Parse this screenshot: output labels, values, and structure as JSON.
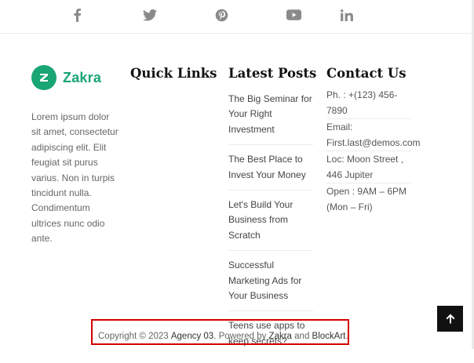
{
  "social": {
    "icons": [
      "facebook-icon",
      "twitter-icon",
      "pinterest-icon",
      "youtube-icon",
      "linkedin-icon"
    ],
    "icon_color": "#8a8a8a"
  },
  "brand": {
    "name": "Zakra",
    "color": "#19a574",
    "about": "Lorem ipsum dolor sit amet, consectetur adipiscing elit. Elit feugiat sit purus varius. Non in turpis tincidunt nulla. Condimentum ultrices nunc odio ante."
  },
  "columns": {
    "quick_links_title": "Quick Links",
    "latest_posts_title": "Latest Posts",
    "contact_title": "Contact Us"
  },
  "latest_posts": [
    "The Big Seminar for Your Right Investment",
    "The Best Place to Invest Your Money",
    "Let's Build Your Business from Scratch",
    "Successful Marketing Ads for Your Business",
    "Teens use apps to keep secrets?"
  ],
  "contact": {
    "phone": "Ph. : +(123) 456-7890",
    "email_label": "Email:",
    "email": "First.last@demos.com",
    "location_line1": "Loc: Moon Street ,",
    "location_line2": "446 Jupiter",
    "hours_line1": "Open : 9AM – 6PM",
    "hours_line2": "(Mon – Fri)"
  },
  "footer": {
    "prefix": "Copyright © 2023 ",
    "agency": "Agency 03",
    "middle": ". Powered by ",
    "zakra": "Zakra",
    "and": " and ",
    "blockart": "BlockArt",
    "suffix": ".",
    "highlight_color": "#d40000"
  },
  "back_to_top": {
    "icon": "arrow-up-icon"
  }
}
